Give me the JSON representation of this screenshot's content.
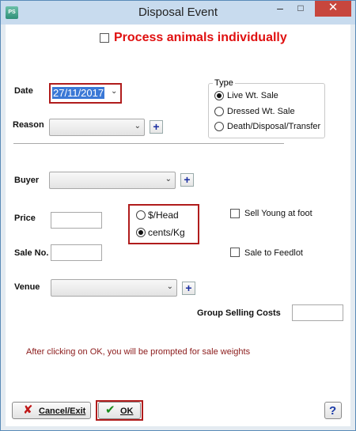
{
  "window": {
    "title": "Disposal Event",
    "app_icon": "PS",
    "controls": {
      "minimize": "–",
      "maximize": "□",
      "close": "✕"
    }
  },
  "header": {
    "process_individually_label": "Process animals individually",
    "process_individually_checked": false
  },
  "date": {
    "label": "Date",
    "value": "27/11/2017"
  },
  "reason": {
    "label": "Reason",
    "value": ""
  },
  "type_group": {
    "label": "Type",
    "options": [
      "Live Wt. Sale",
      "Dressed Wt. Sale",
      "Death/Disposal/Transfer"
    ],
    "selected": "Live Wt. Sale"
  },
  "buyer": {
    "label": "Buyer",
    "value": ""
  },
  "price": {
    "label": "Price",
    "value": ""
  },
  "price_unit": {
    "options": [
      "$/Head",
      "cents/Kg"
    ],
    "selected": "cents/Kg"
  },
  "sell_young": {
    "label": "Sell Young at foot",
    "checked": false
  },
  "sale_no": {
    "label": "Sale No.",
    "value": ""
  },
  "sale_to_feedlot": {
    "label": "Sale to Feedlot",
    "checked": false
  },
  "venue": {
    "label": "Venue",
    "value": ""
  },
  "group_selling_costs": {
    "label": "Group Selling Costs",
    "value": ""
  },
  "note": "After clicking on OK, you will be prompted for sale weights",
  "buttons": {
    "cancel": "Cancel/Exit",
    "ok": "OK",
    "help": "?",
    "add": "+"
  },
  "colors": {
    "heading": "#e01010",
    "highlight_border": "#b01c1c",
    "note": "#8b1a1a",
    "add_icon": "#1a2ea0",
    "cancel_icon": "#c01818",
    "ok_icon": "#1a8a1a"
  },
  "icons": [
    "app-icon",
    "x-icon",
    "check-icon",
    "help-icon",
    "plus-icon",
    "chevron-down-icon"
  ]
}
